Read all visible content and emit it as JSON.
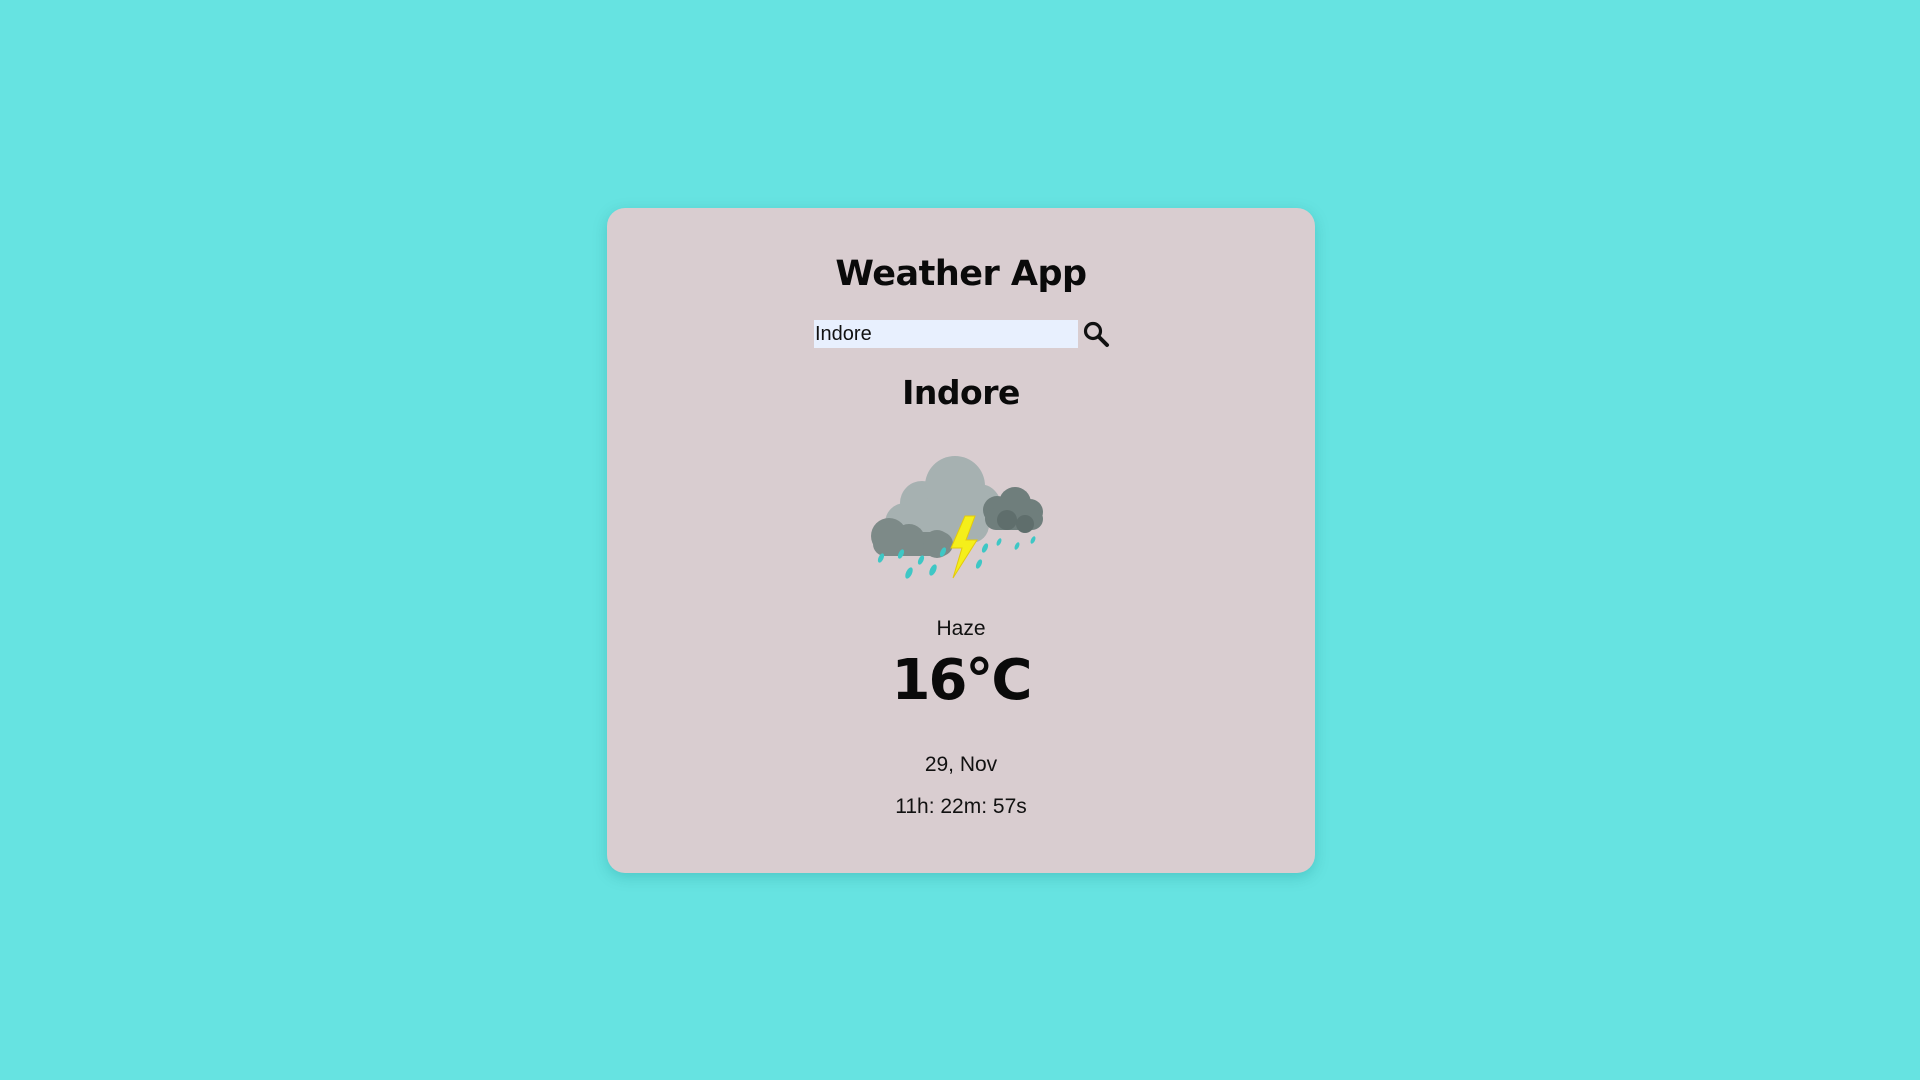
{
  "app": {
    "title": "Weather App"
  },
  "search": {
    "value": "Indore",
    "icon": "search-icon"
  },
  "weather": {
    "city": "Indore",
    "icon": "thunderstorm-rain-icon",
    "condition": "Haze",
    "temperature": "16°C",
    "date": "29, Nov",
    "time": "11h: 22m: 57s"
  },
  "colors": {
    "background": "#66e3e1",
    "card": "#d9cdd0",
    "input_background": "#e8f0fe",
    "text": "#0a0a0a"
  }
}
